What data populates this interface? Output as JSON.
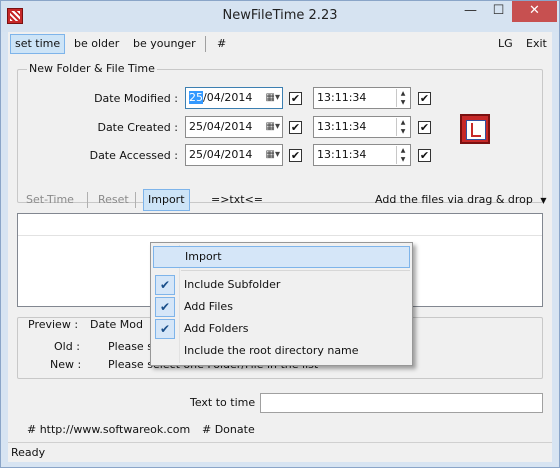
{
  "window": {
    "title": "NewFileTime 2.23",
    "buttons": {
      "minimize": "—",
      "maximize": "☐",
      "close": "✕"
    }
  },
  "menubar": {
    "items": [
      "set time",
      "be older",
      "be younger",
      "#"
    ],
    "right": [
      "LG",
      "Exit"
    ]
  },
  "group": {
    "title": "New Folder & File Time",
    "rows": [
      {
        "label": "Date Modified :",
        "date_sel": "25",
        "date_rest": "/04/2014",
        "time": "13:11:34"
      },
      {
        "label": "Date Created :",
        "date": "25/04/2014",
        "time": "13:11:34"
      },
      {
        "label": "Date Accessed :",
        "date": "25/04/2014",
        "time": "13:11:34"
      }
    ],
    "check_mark": "✔"
  },
  "toolbar": {
    "set_time": "Set-Time",
    "reset": "Reset",
    "import": "Import",
    "txt": "=>txt<=",
    "drag_drop": "Add the files via drag & drop",
    "drag_arrow": "▼"
  },
  "context_menu": {
    "items": [
      {
        "label": "Import",
        "checked": false
      },
      {
        "label": "Include Subfolder",
        "checked": true
      },
      {
        "label": "Add Files",
        "checked": true
      },
      {
        "label": "Add Folders",
        "checked": true
      },
      {
        "label": "Include the root directory name",
        "checked": false
      }
    ],
    "check_glyph": "✔"
  },
  "preview": {
    "label": "Preview :",
    "date_mod": "Date Mod",
    "old_label": "Old :",
    "old_text": "Please select one Folder/File in the list",
    "new_label": "New :",
    "new_text": "Please select one Folder/File in the list"
  },
  "text_to_time": {
    "label": "Text to time",
    "value": ""
  },
  "links": {
    "website": "# http://www.softwareok.com",
    "donate": "# Donate"
  },
  "status": {
    "text": "Ready"
  },
  "colors": {
    "selection": "#3399ff",
    "highlight": "#d5e6f8",
    "close_button": "#c75050"
  }
}
